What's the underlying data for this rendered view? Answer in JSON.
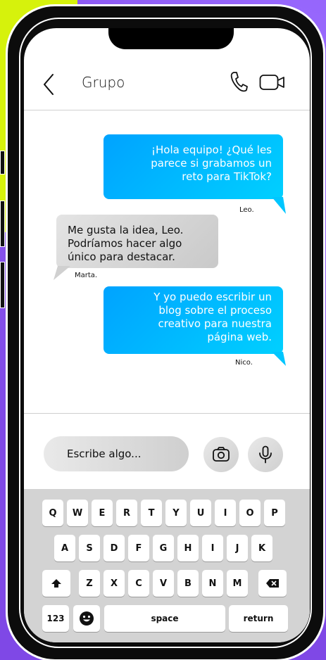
{
  "header": {
    "title": "Grupo",
    "icons": {
      "back": "chevron-left-icon",
      "call": "phone-icon",
      "video": "video-camera-icon"
    }
  },
  "messages": [
    {
      "side": "out",
      "text_lines": [
        "¡Hola equipo! ¿Qué les",
        "parece si grabamos un",
        "reto para TikTok?"
      ],
      "sender": "Leo."
    },
    {
      "side": "in",
      "text_lines": [
        "Me gusta la idea, Leo.",
        "Podríamos hacer algo",
        "único para destacar."
      ],
      "sender": "Marta."
    },
    {
      "side": "out",
      "text_lines": [
        "Y yo puedo escribir un",
        "blog sobre el proceso",
        "creativo para nuestra",
        "página web."
      ],
      "sender": "Nico."
    }
  ],
  "composer": {
    "placeholder": "Escribe algo...",
    "icons": {
      "camera": "camera-icon",
      "mic": "microphone-icon"
    }
  },
  "keyboard": {
    "row1": [
      "Q",
      "W",
      "E",
      "R",
      "T",
      "Y",
      "U",
      "I",
      "O",
      "P"
    ],
    "row2": [
      "A",
      "S",
      "D",
      "F",
      "G",
      "H",
      "I",
      "J",
      "K"
    ],
    "row3": [
      "Z",
      "X",
      "C",
      "V",
      "B",
      "N",
      "M"
    ],
    "shift_icon": "shift-arrow-icon",
    "delete_icon": "backspace-icon",
    "numbers_label": "123",
    "emoji_icon": "emoji-smile-icon",
    "space_label": "space",
    "return_label": "return"
  },
  "colors": {
    "outgoing_bubble": "#00b8ff",
    "incoming_bubble": "#d6d6d6",
    "background_purple": "#8f5cf0",
    "background_yellow": "#d6f20c"
  }
}
